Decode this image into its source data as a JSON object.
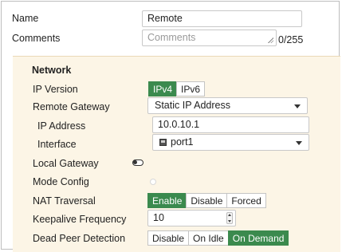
{
  "name": {
    "label": "Name",
    "value": "Remote"
  },
  "comments": {
    "label": "Comments",
    "placeholder": "Comments",
    "counter": "0/255"
  },
  "network": {
    "title": "Network",
    "ip_version": {
      "label": "IP Version",
      "options": [
        "IPv4",
        "IPv6"
      ],
      "selected": "IPv4"
    },
    "remote_gateway": {
      "label": "Remote Gateway",
      "value": "Static IP Address"
    },
    "ip_address": {
      "label": "IP Address",
      "value": "10.0.10.1"
    },
    "interface": {
      "label": "Interface",
      "value": "port1"
    },
    "local_gateway": {
      "label": "Local Gateway",
      "enabled": false
    },
    "mode_config": {
      "label": "Mode Config",
      "enabled": false
    },
    "nat_traversal": {
      "label": "NAT Traversal",
      "options": [
        "Enable",
        "Disable",
        "Forced"
      ],
      "selected": "Enable"
    },
    "keepalive": {
      "label": "Keepalive Frequency",
      "value": "10"
    },
    "dpd": {
      "label": "Dead Peer Detection",
      "options": [
        "Disable",
        "On Idle",
        "On Demand"
      ],
      "selected": "On Demand"
    }
  },
  "colors": {
    "accent": "#3b8a4e",
    "section_bg": "#fcf5e6"
  }
}
